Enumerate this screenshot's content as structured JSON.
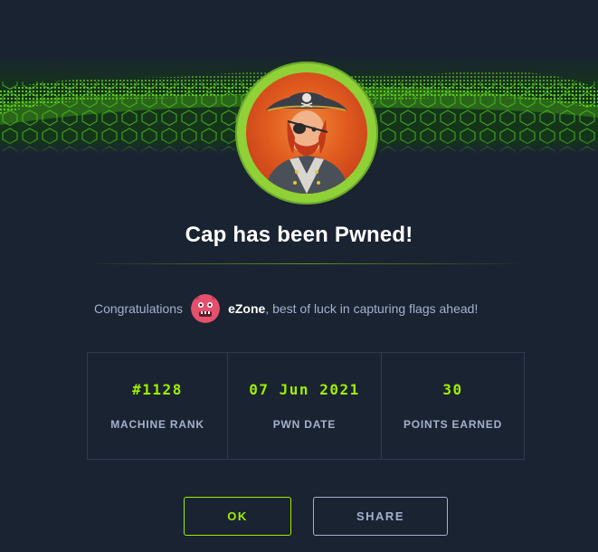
{
  "modal": {
    "title": "Cap has been Pwned!",
    "congrats_prefix": "Congratulations",
    "username": "eZone",
    "congrats_suffix": ", best of luck in capturing flags ahead!"
  },
  "stats": [
    {
      "value": "#1128",
      "label": "MACHINE RANK"
    },
    {
      "value": "07 Jun 2021",
      "label": "PWN DATE"
    },
    {
      "value": "30",
      "label": "POINTS EARNED"
    }
  ],
  "buttons": {
    "ok_label": "OK",
    "share_label": "SHARE"
  },
  "colors": {
    "background": "#1a2332",
    "accent": "#9fef00",
    "muted": "#a4b1cd",
    "avatar_ring": "#8fd137"
  },
  "icons": {
    "machine_avatar": "pirate-captain-icon",
    "user_avatar": "pink-monster-avatar-icon"
  }
}
